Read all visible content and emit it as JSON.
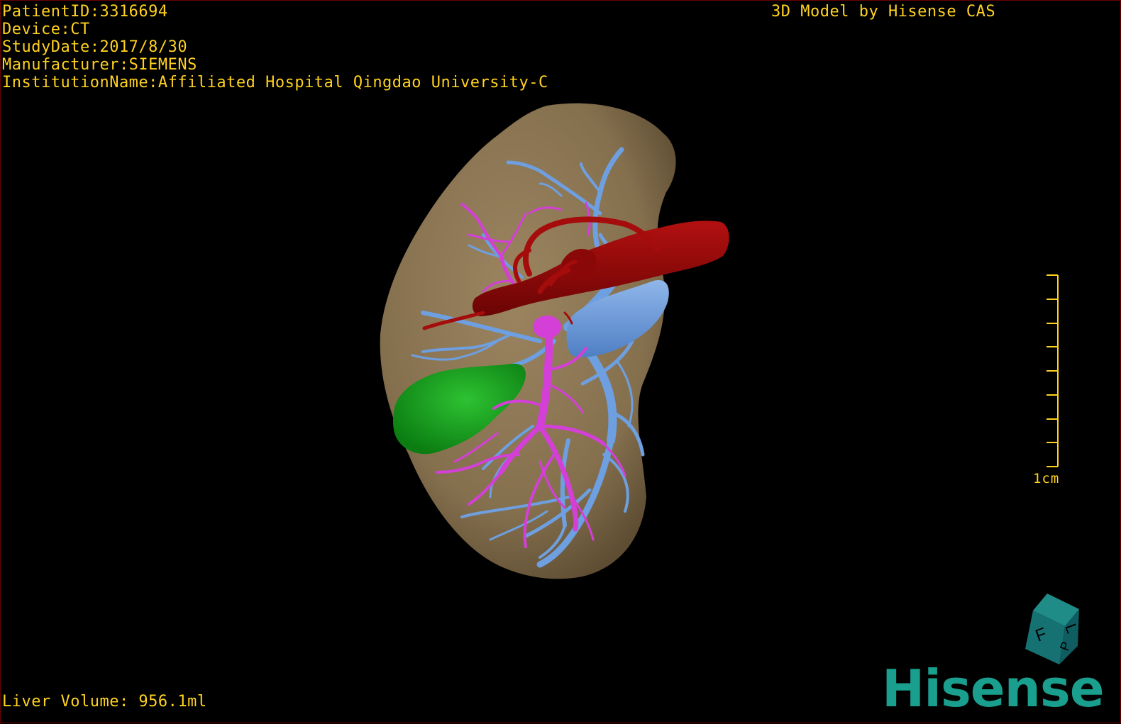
{
  "viewer": {
    "patient_id": "PatientID:3316694",
    "device": "Device:CT",
    "study_date": "StudyDate:2017/8/30",
    "manufacturer": "Manufacturer:SIEMENS",
    "institution": "InstitutionName:Affiliated Hospital Qingdao University-C",
    "model_credit": "3D Model by Hisense CAS",
    "liver_volume": "Liver Volume: 956.1ml",
    "scale_label": "1cm",
    "brand": "Hisense",
    "orientation_cube_letters": [
      "F",
      "L",
      "P"
    ]
  },
  "colors": {
    "overlay_text": "#ffd21f",
    "liver": "#8b7452",
    "artery": "#9c0a0a",
    "portal_vein": "#6e9fe0",
    "biliary": "#d43fd8",
    "gallbladder": "#13a21b",
    "brand": "#1a9e8e"
  },
  "icons": {
    "orientation": "orientation-cube-icon",
    "scale": "scale-bar-icon"
  }
}
